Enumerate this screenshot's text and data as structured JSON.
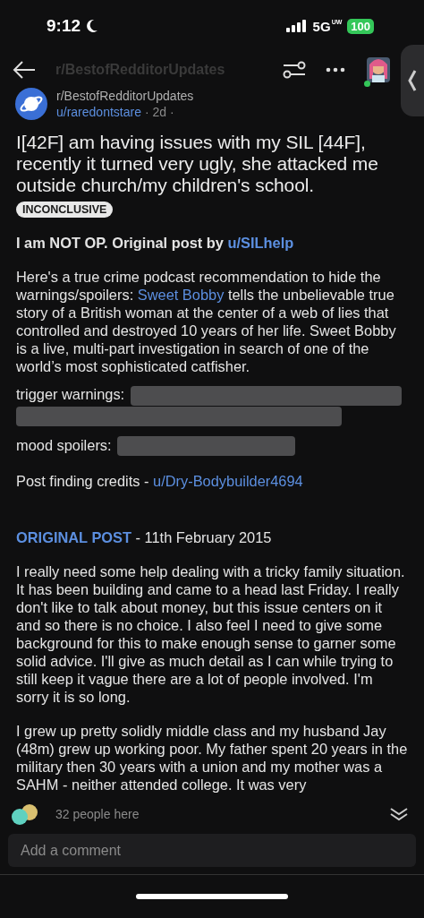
{
  "status_bar": {
    "time": "9:12",
    "network": "5G",
    "network_sup": "UW",
    "battery": "100"
  },
  "header": {
    "title": "r/BestofRedditorUpdates",
    "avatar_online": true
  },
  "post": {
    "subreddit": "r/BestofRedditorUpdates",
    "author": "u/raredontstare",
    "age": "· 2d ·",
    "title": "I[42F] am having issues with my SIL [44F], recently it turned very ugly, she attacked me outside church/my children's school.",
    "flair": "INCONCLUSIVE",
    "blocks": [
      {
        "kind": "byline",
        "text": "I am NOT OP. Original post by ",
        "link": "u/SILhelp"
      },
      {
        "kind": "linked",
        "before": "Here's a true crime podcast recommendation to hide the warnings/spoilers: ",
        "link": "Sweet Bobby",
        "after": " tells the unbelievable true story of a British woman at the center of a web of lies that controlled and destroyed 10 years of her life.  Sweet Bobby is a live, multi-part investigation in search of one of the world’s most sophisticated catfisher."
      },
      {
        "kind": "longspoiler",
        "label": "trigger warnings:"
      },
      {
        "kind": "spoiler",
        "label": "mood spoilers:"
      },
      {
        "kind": "credit",
        "text": "Post finding credits - ",
        "link": "u/Dry-Bodybuilder4694"
      },
      {
        "kind": "heading",
        "link": "ORIGINAL POST",
        "text": " - 11th February 2015"
      },
      {
        "kind": "paragraph",
        "text": "I really need some help dealing with a tricky family situation. It has been building and came to a head last Friday. I really don't like to talk about money, but this issue centers on it and so there is no choice. I also feel I need to give some background for this to make enough sense to garner some solid advice. I'll give as much detail as I can while trying to still keep it vague there are a lot of people involved. I'm sorry it is so long."
      },
      {
        "kind": "paragraph",
        "text": "I grew up pretty solidly middle class and my husband Jay (48m) grew up working poor. My father spent 20 years in the military then 30 years with a union and my mother was a SAHM - neither attended college. It was very"
      }
    ]
  },
  "presence": {
    "text": "32 people here"
  },
  "comment": {
    "placeholder": "Add a comment"
  }
}
